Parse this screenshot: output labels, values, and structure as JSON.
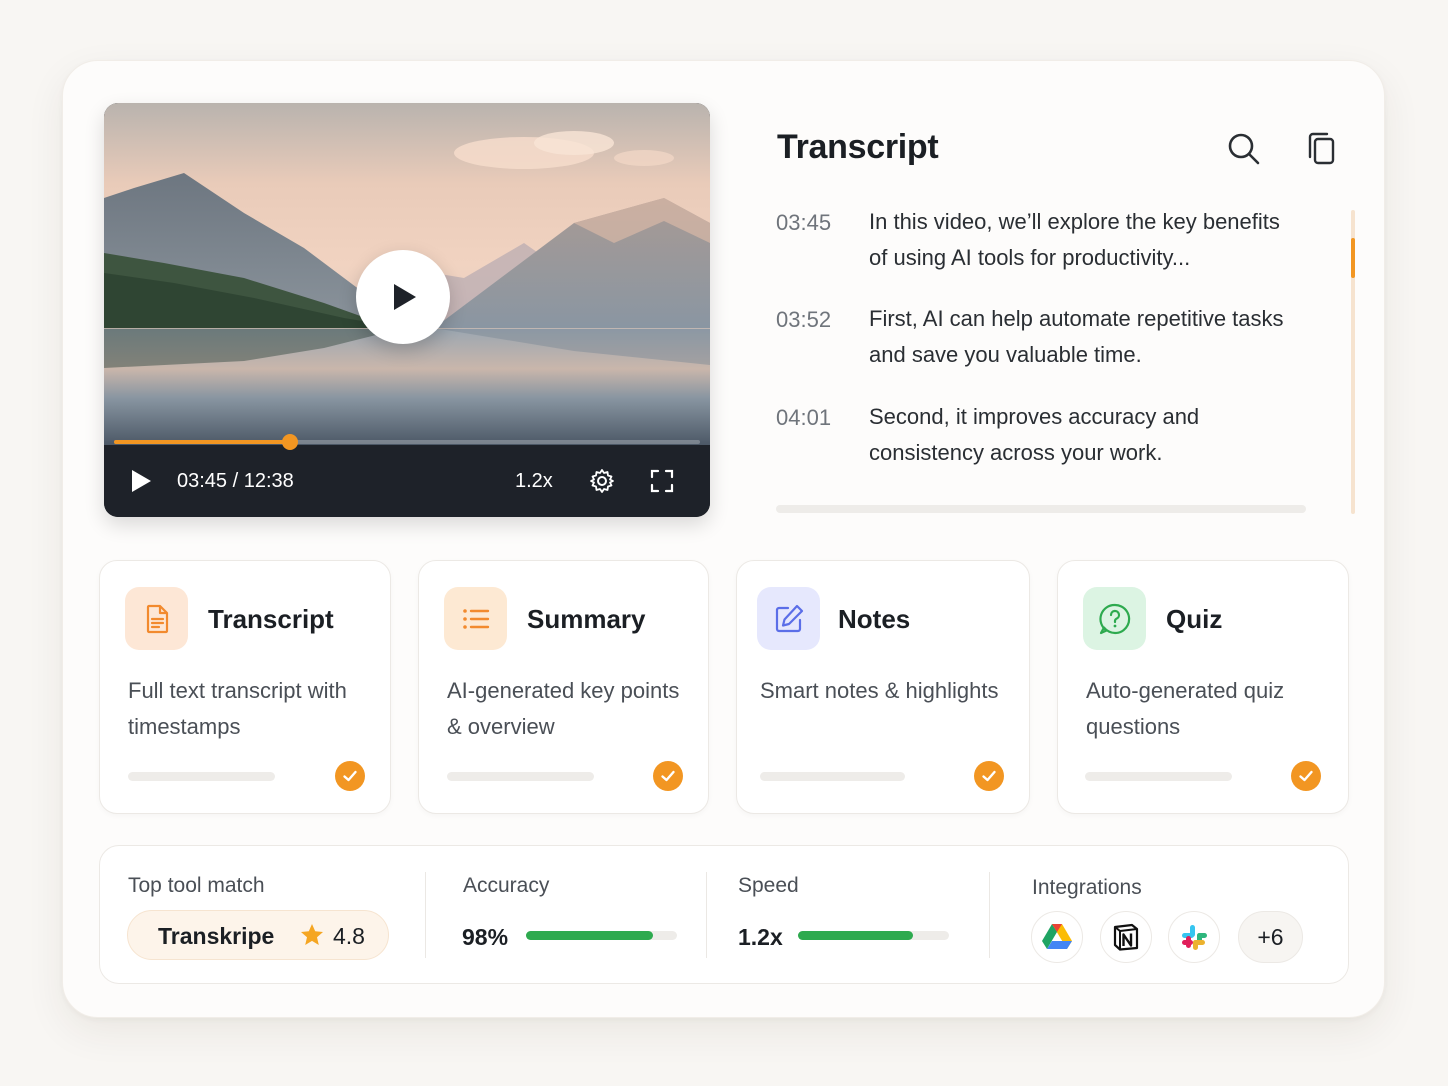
{
  "player": {
    "current_time": "03:45",
    "duration": "12:38",
    "time_display": "03:45 / 12:38",
    "progress": 0.3,
    "speed": "1.2x",
    "accent": "#f29622"
  },
  "transcript": {
    "title": "Transcript",
    "entries": [
      {
        "time": "03:45",
        "text": "In this video, we’ll explore the key benefits of using AI tools for productivity..."
      },
      {
        "time": "03:52",
        "text": "First, AI can help automate repetitive tasks and save you valuable time."
      },
      {
        "time": "04:01",
        "text": "Second, it improves accuracy and consistency across your work."
      }
    ]
  },
  "features": [
    {
      "title": "Transcript",
      "description": "Full text transcript with timestamps",
      "icon": "document-icon",
      "color": "#f28a2e",
      "bg": "#fde7d6"
    },
    {
      "title": "Summary",
      "description": "AI-generated key points & overview",
      "icon": "list-icon",
      "color": "#f28a2e",
      "bg": "#fde9d3"
    },
    {
      "title": "Notes",
      "description": "Smart notes & highlights",
      "icon": "edit-icon",
      "color": "#5b6ee8",
      "bg": "#e6e8fd"
    },
    {
      "title": "Quiz",
      "description": "Auto-generated quiz questions",
      "icon": "question-icon",
      "color": "#2eaa4f",
      "bg": "#dcf4e3"
    }
  ],
  "stats": {
    "top_match_label": "Top tool match",
    "top_match_name": "Transkripe",
    "top_match_rating": "4.8",
    "accuracy_label": "Accuracy",
    "accuracy_value": "98%",
    "accuracy_fraction": 0.84,
    "speed_label": "Speed",
    "speed_value": "1.2x",
    "speed_fraction": 0.76,
    "integrations_label": "Integrations",
    "integrations": [
      "google-drive-icon",
      "notion-icon",
      "slack-icon"
    ],
    "integrations_more": "+6",
    "bar_color": "#2eaa4f"
  }
}
